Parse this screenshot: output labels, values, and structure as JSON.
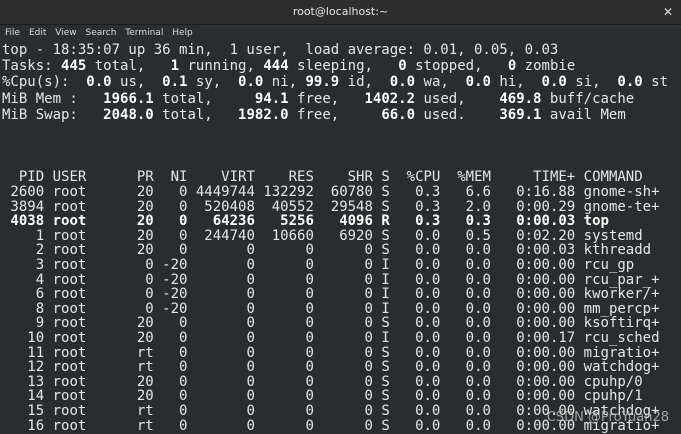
{
  "window": {
    "title": "root@localhost:~",
    "close_icon": "close-icon"
  },
  "menu": [
    "File",
    "Edit",
    "View",
    "Search",
    "Terminal",
    "Help"
  ],
  "summary": [
    [
      {
        "t": "top - 18:35:07 up 36 min,  1 user,  load average: 0.01, 0.05, 0.03"
      }
    ],
    [
      {
        "t": "Tasks: "
      },
      {
        "t": "445",
        "b": 1
      },
      {
        "t": " total,   "
      },
      {
        "t": "1",
        "b": 1
      },
      {
        "t": " running, "
      },
      {
        "t": "444",
        "b": 1
      },
      {
        "t": " sleeping,   "
      },
      {
        "t": "0",
        "b": 1
      },
      {
        "t": " stopped,   "
      },
      {
        "t": "0",
        "b": 1
      },
      {
        "t": " zombie"
      }
    ],
    [
      {
        "t": "%Cpu(s):  "
      },
      {
        "t": "0.0",
        "b": 1
      },
      {
        "t": " us,  "
      },
      {
        "t": "0.1",
        "b": 1
      },
      {
        "t": " sy,  "
      },
      {
        "t": "0.0",
        "b": 1
      },
      {
        "t": " ni, "
      },
      {
        "t": "99.9",
        "b": 1
      },
      {
        "t": " id,  "
      },
      {
        "t": "0.0",
        "b": 1
      },
      {
        "t": " wa,  "
      },
      {
        "t": "0.0",
        "b": 1
      },
      {
        "t": " hi,  "
      },
      {
        "t": "0.0",
        "b": 1
      },
      {
        "t": " si,  "
      },
      {
        "t": "0.0",
        "b": 1
      },
      {
        "t": " st"
      }
    ],
    [
      {
        "t": "MiB Mem :   "
      },
      {
        "t": "1966.1",
        "b": 1
      },
      {
        "t": " total,     "
      },
      {
        "t": "94.1",
        "b": 1
      },
      {
        "t": " free,   "
      },
      {
        "t": "1402.2",
        "b": 1
      },
      {
        "t": " used,    "
      },
      {
        "t": "469.8",
        "b": 1
      },
      {
        "t": " buff/cache"
      }
    ],
    [
      {
        "t": "MiB Swap:   "
      },
      {
        "t": "2048.0",
        "b": 1
      },
      {
        "t": " total,   "
      },
      {
        "t": "1982.0",
        "b": 1
      },
      {
        "t": " free,     "
      },
      {
        "t": "66.0",
        "b": 1
      },
      {
        "t": " used.    "
      },
      {
        "t": "369.1",
        "b": 1
      },
      {
        "t": " avail Mem"
      }
    ]
  ],
  "columns": [
    "PID",
    "USER",
    "PR",
    "NI",
    "VIRT",
    "RES",
    "SHR",
    "S",
    "%CPU",
    "%MEM",
    "TIME+",
    "COMMAND"
  ],
  "processes": [
    [
      "2600",
      "root",
      "20",
      "0",
      "4449744",
      "132292",
      "60780",
      "S",
      "0.3",
      "6.6",
      "0:16.88",
      "gnome-sh+"
    ],
    [
      "3894",
      "root",
      "20",
      "0",
      "520408",
      "40552",
      "29548",
      "S",
      "0.3",
      "2.0",
      "0:00.29",
      "gnome-te+"
    ],
    [
      "4038",
      "root",
      "20",
      "0",
      "64236",
      "5256",
      "4096",
      "R",
      "0.3",
      "0.3",
      "0:00.03",
      "top"
    ],
    [
      "1",
      "root",
      "20",
      "0",
      "244740",
      "10660",
      "6920",
      "S",
      "0.0",
      "0.5",
      "0:02.20",
      "systemd"
    ],
    [
      "2",
      "root",
      "20",
      "0",
      "0",
      "0",
      "0",
      "S",
      "0.0",
      "0.0",
      "0:00.03",
      "kthreadd"
    ],
    [
      "3",
      "root",
      "0",
      "-20",
      "0",
      "0",
      "0",
      "I",
      "0.0",
      "0.0",
      "0:00.00",
      "rcu_gp"
    ],
    [
      "4",
      "root",
      "0",
      "-20",
      "0",
      "0",
      "0",
      "I",
      "0.0",
      "0.0",
      "0:00.00",
      "rcu_par_+"
    ],
    [
      "6",
      "root",
      "0",
      "-20",
      "0",
      "0",
      "0",
      "I",
      "0.0",
      "0.0",
      "0:00.00",
      "kworker/+"
    ],
    [
      "8",
      "root",
      "0",
      "-20",
      "0",
      "0",
      "0",
      "I",
      "0.0",
      "0.0",
      "0:00.00",
      "mm_percp+"
    ],
    [
      "9",
      "root",
      "20",
      "0",
      "0",
      "0",
      "0",
      "S",
      "0.0",
      "0.0",
      "0:00.00",
      "ksoftirq+"
    ],
    [
      "10",
      "root",
      "20",
      "0",
      "0",
      "0",
      "0",
      "I",
      "0.0",
      "0.0",
      "0:00.17",
      "rcu_sched"
    ],
    [
      "11",
      "root",
      "rt",
      "0",
      "0",
      "0",
      "0",
      "S",
      "0.0",
      "0.0",
      "0:00.00",
      "migratio+"
    ],
    [
      "12",
      "root",
      "rt",
      "0",
      "0",
      "0",
      "0",
      "S",
      "0.0",
      "0.0",
      "0:00.00",
      "watchdog+"
    ],
    [
      "13",
      "root",
      "20",
      "0",
      "0",
      "0",
      "0",
      "S",
      "0.0",
      "0.0",
      "0:00.00",
      "cpuhp/0"
    ],
    [
      "14",
      "root",
      "20",
      "0",
      "0",
      "0",
      "0",
      "S",
      "0.0",
      "0.0",
      "0:00.00",
      "cpuhp/1"
    ],
    [
      "15",
      "root",
      "rt",
      "0",
      "0",
      "0",
      "0",
      "S",
      "0.0",
      "0.0",
      "0:00.00",
      "watchdog+"
    ],
    [
      "16",
      "root",
      "rt",
      "0",
      "0",
      "0",
      "0",
      "S",
      "0.0",
      "0.0",
      "0:00.00",
      "migratio+"
    ]
  ],
  "highlight_pid": "4038",
  "watermark": "CSDN @ProYuan28"
}
